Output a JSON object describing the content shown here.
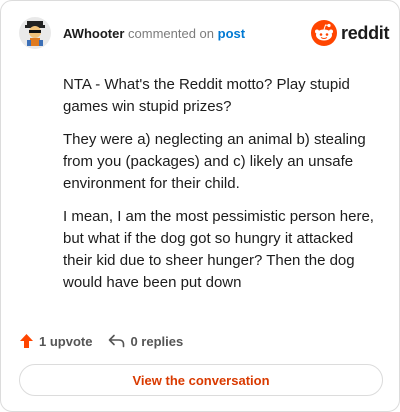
{
  "header": {
    "author": "AWhooter",
    "commented_on": "commented on",
    "post_link": "post"
  },
  "brand": {
    "wordmark": "reddit",
    "accent_color": "#ff4500"
  },
  "comment": {
    "paragraphs": [
      "NTA - What's the Reddit motto? Play stupid games win stupid prizes?",
      "They were a) neglecting an animal b) stealing from you (packages) and c) likely an unsafe environment for their child.",
      "I mean, I am the most pessimistic person here, but what if the dog got so hungry it attacked their kid due to sheer hunger? Then the dog would have been put down"
    ]
  },
  "actions": {
    "upvote_label": "1 upvote",
    "reply_label": "0 replies"
  },
  "cta": {
    "label": "View the conversation"
  },
  "icons": {
    "avatar": "user-avatar",
    "logo": "reddit-alien-icon",
    "upvote": "upvote-arrow-icon",
    "reply": "reply-arrow-icon"
  }
}
